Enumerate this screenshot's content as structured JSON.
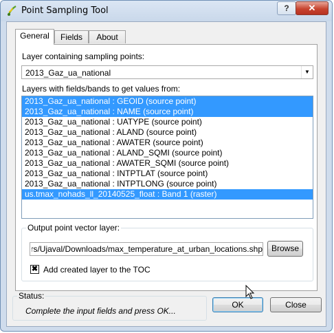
{
  "window": {
    "title": "Point Sampling Tool",
    "help_label": "?",
    "close_label": "✕"
  },
  "tabs": [
    {
      "label": "General",
      "active": true
    },
    {
      "label": "Fields",
      "active": false
    },
    {
      "label": "About",
      "active": false
    }
  ],
  "general": {
    "layer_label": "Layer containing sampling points:",
    "layer_value": "2013_Gaz_ua_national",
    "fields_label": "Layers with fields/bands to get values from:",
    "fields": [
      {
        "text": "2013_Gaz_ua_national : GEOID (source point)",
        "selected": true
      },
      {
        "text": "2013_Gaz_ua_national : NAME (source point)",
        "selected": true
      },
      {
        "text": "2013_Gaz_ua_national : UATYPE (source point)",
        "selected": false
      },
      {
        "text": "2013_Gaz_ua_national : ALAND (source point)",
        "selected": false
      },
      {
        "text": "2013_Gaz_ua_national : AWATER (source point)",
        "selected": false
      },
      {
        "text": "2013_Gaz_ua_national : ALAND_SQMI (source point)",
        "selected": false
      },
      {
        "text": "2013_Gaz_ua_national : AWATER_SQMI (source point)",
        "selected": false
      },
      {
        "text": "2013_Gaz_ua_national : INTPTLAT (source point)",
        "selected": false
      },
      {
        "text": "2013_Gaz_ua_national : INTPTLONG (source point)",
        "selected": false
      },
      {
        "text": "us.tmax_nohads_ll_20140525_float : Band 1 (raster)",
        "selected": true
      }
    ],
    "output_group_label": "Output point vector layer:",
    "output_path": "C:/Users/Ujaval/Downloads/max_temperature_at_urban_locations.shp",
    "browse_label": "Browse",
    "add_layer_label": "Add created layer to the TOC",
    "add_layer_checked": true
  },
  "status": {
    "label": "Status:",
    "text": "Complete the input fields and press OK..."
  },
  "buttons": {
    "ok": "OK",
    "close": "Close"
  },
  "colors": {
    "selection": "#3399ff",
    "close_button": "#c7442f"
  }
}
